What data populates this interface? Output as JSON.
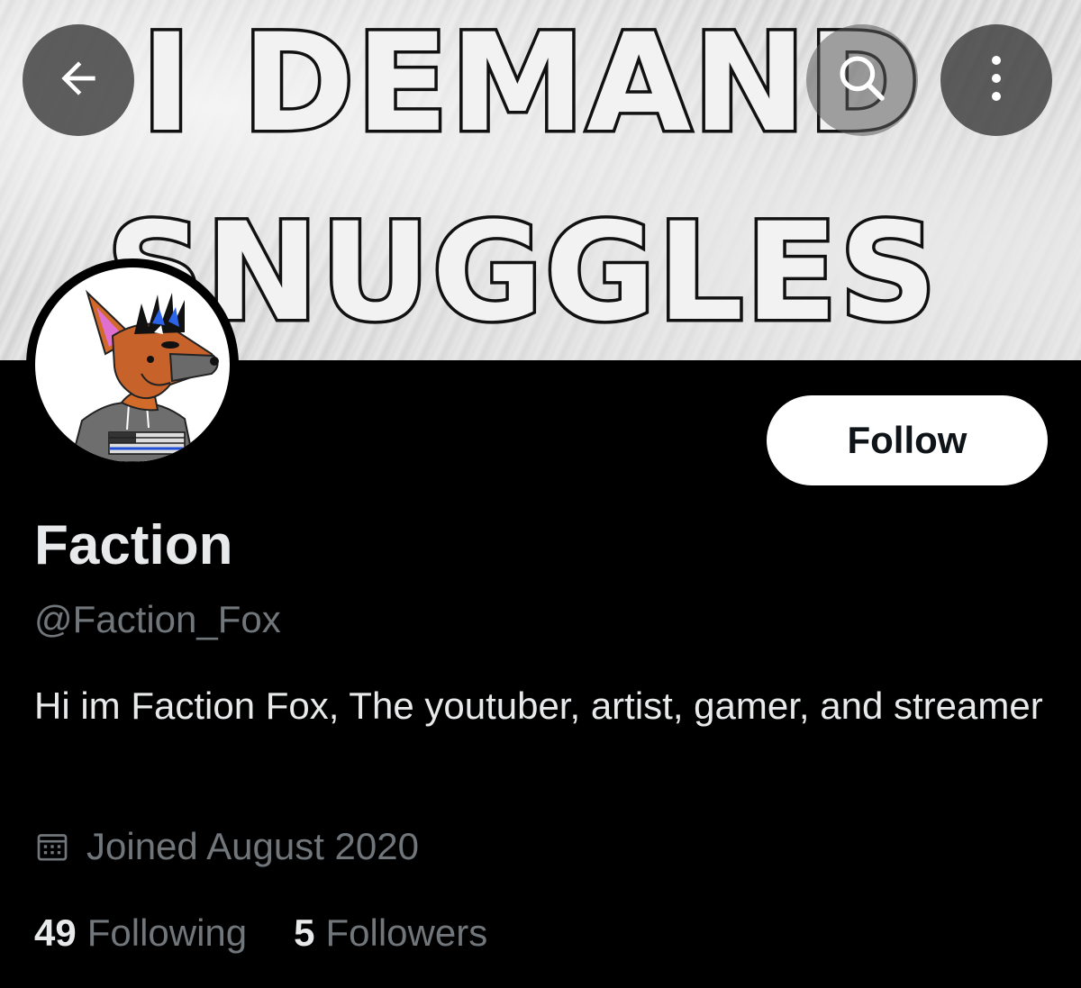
{
  "banner": {
    "line1": "I DEMAND",
    "line2": "SNUGGLES"
  },
  "icons": {
    "back": "arrow-left-icon",
    "search": "search-icon",
    "more": "more-vertical-icon",
    "calendar": "calendar-icon"
  },
  "profile": {
    "follow_label": "Follow",
    "display_name": "Faction",
    "handle": "@Faction_Fox",
    "bio": "Hi im Faction Fox, The youtuber, artist, gamer, and streamer",
    "joined": "Joined August 2020"
  },
  "stats": {
    "following_count": "49",
    "following_label": "Following",
    "followers_count": "5",
    "followers_label": "Followers"
  },
  "colors": {
    "background": "#000000",
    "primary_text": "#e7e9ea",
    "secondary_text": "#71767b",
    "follow_button_bg": "#ffffff"
  }
}
